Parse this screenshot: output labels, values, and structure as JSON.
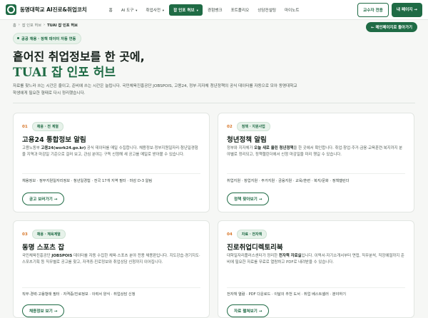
{
  "header": {
    "logo_text": "동명대학교 AI진로&취업코치",
    "nav": [
      {
        "label": "홈"
      },
      {
        "label": "AI 도구",
        "chev": "▾"
      },
      {
        "label": "취업사전",
        "chev": "▾"
      },
      {
        "label": "잡 인포 허브",
        "chev": "▾",
        "active": true
      },
      {
        "label": "경험뱅크"
      },
      {
        "label": "포트폴리오"
      },
      {
        "label": "상담컨설팅"
      },
      {
        "label": "마이노트"
      }
    ],
    "faculty_btn": "교수자 전용",
    "mypage_btn": "내 페이지 →"
  },
  "breadcrumb": [
    "홈",
    "›",
    "잡 인포 허브",
    "›",
    "TUAI 잡 인포 허브"
  ],
  "back_btn": "← 메인페이지로 돌아가기",
  "hero": {
    "tag": "공공 채용 · 정책 데이터 자동 연동",
    "title": "흩어진 취업정보를 한 곳에,",
    "title2": "TUAI 잡 인포 허브",
    "desc": "자료를 찾느라 쓰는 시간은 줄이고, 준비에 쓰는 시간은 늘립니다. 국민체육진흥공단 JOBSPOIS, 고용24, 정부·지자체 청년정책의 공식 데이터를 자동으로 모아 동명대학교 학생에게 필요한 형태로 다시 정리했습니다."
  },
  "cards": [
    {
      "num": "01",
      "chip": "채용 · 전 계열",
      "title": "고용24 통합정보 알림",
      "desc_pre": "고용노동부 ",
      "desc_bold": "고용24(work24.go.kr)",
      "desc_post": " 공식 데이터를 매일 수집합니다. 채용정보·정부지원일자리·청년일경험을 지역과 마감일 기준으로 걸러 보고, 관심 분야는 구독 신청해 새 공고를 메일로 받아볼 수 있습니다.",
      "meta": "채용정보 · 정부지원일자리정보 · 청년일경험 · 전국 17개 지역 필터 · 마감 D-3 알림",
      "btn": "공고 보러가기 →"
    },
    {
      "num": "02",
      "chip": "정책 · 지원사업",
      "title": "청년정책 알림",
      "desc_pre": "정부와 지자체가 ",
      "desc_bold": "오늘 새로 올린 청년정책",
      "desc_post": "을 한 곳에서 확인합니다. 취업·창업·주거·금융·교육훈련·복지까지 분야별로 정리되고, 정책챌린더에서 신청 마감일을 미리 챙길 수 있습니다.",
      "meta": "취업지원 · 창업지원 · 주거지원 · 금융지원 · 교육/훈련 · 복지/문화 · 정책캘린더",
      "btn": "정책 찾아보기 →"
    },
    {
      "num": "03",
      "chip": "채용 · 체육계열",
      "title": "동명 스포츠 잡",
      "desc_pre": "국민체육진흥공단 ",
      "desc_bold": "JOBSPOIS",
      "desc_post": " 데이터를 자동 수집한 체육·스포츠 분야 전용 채용판입니다. 지도강습·경기지도·스포츠기획 등 직무별로 공고를 찾고, 자격증·진로정보와 취업상담 신청까지 이어집니다.",
      "meta": "직무·경력·고용형태 필터 · 자격증/진로정보 · 이력서 양식 · 취업상담 신청",
      "btn": "채용정보 보기 →"
    },
    {
      "num": "04",
      "chip": "자료 · 전자책",
      "title": "진로취업디렉토리북",
      "desc_pre": "대학일자리플러스센터가 정리한 ",
      "desc_bold": "전자책 자료실",
      "desc_post": "입니다. 이력서·자기소개서부터 면접, 직무분석, 직장예절까지 준비에 필요한 자료를 무료로 열람하고 PDF로 내려받을 수 있습니다.",
      "meta": "전자책 열람 · PDF 다운로드 · 이달의 추천 도서 · 취업 베스트셀러 · 분야하기",
      "btn": "자료 펼쳐보기 →"
    }
  ]
}
